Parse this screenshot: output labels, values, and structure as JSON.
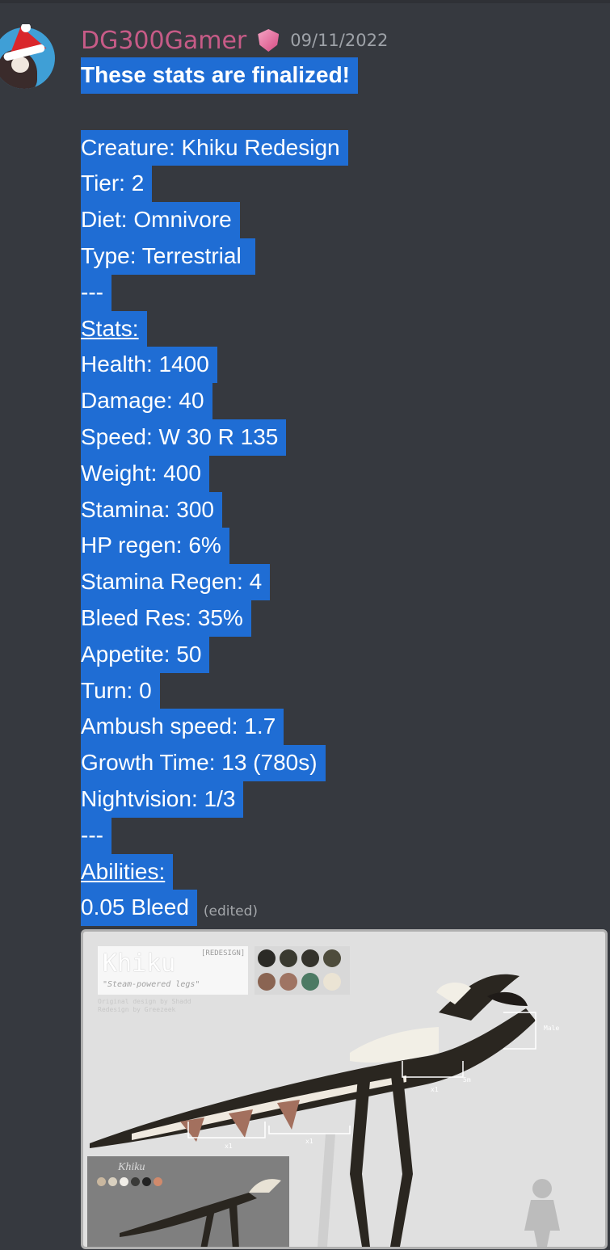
{
  "message": {
    "username": "DG300Gamer",
    "timestamp": "09/11/2022",
    "edited_label": "(edited)",
    "lines": [
      {
        "text": "These stats are finalized!",
        "style": "bold"
      },
      {
        "text": "",
        "style": "blank"
      },
      {
        "text": "Creature: Khiku Redesign",
        "style": "normal"
      },
      {
        "text": "Tier: 2",
        "style": "normal"
      },
      {
        "text": "Diet: Omnivore",
        "style": "normal"
      },
      {
        "text": "Type: Terrestrial ",
        "style": "normal"
      },
      {
        "text": "---",
        "style": "normal"
      },
      {
        "text": "Stats:",
        "style": "underline"
      },
      {
        "text": "Health: 1400",
        "style": "normal"
      },
      {
        "text": "Damage: 40",
        "style": "normal"
      },
      {
        "text": "Speed: W 30 R 135",
        "style": "normal"
      },
      {
        "text": "Weight: 400",
        "style": "normal"
      },
      {
        "text": "Stamina: 300",
        "style": "normal"
      },
      {
        "text": "HP regen: 6%",
        "style": "normal"
      },
      {
        "text": "Stamina Regen: 4",
        "style": "normal"
      },
      {
        "text": "Bleed Res: 35%",
        "style": "normal"
      },
      {
        "text": "Appetite: 50",
        "style": "normal"
      },
      {
        "text": "Turn: 0",
        "style": "normal"
      },
      {
        "text": "Ambush speed: 1.7",
        "style": "normal"
      },
      {
        "text": "Growth Time: 13 (780s)",
        "style": "normal"
      },
      {
        "text": "Nightvision: 1/3",
        "style": "normal"
      },
      {
        "text": "---",
        "style": "normal"
      },
      {
        "text": "Abilities:",
        "style": "underline"
      },
      {
        "text": "0.05 Bleed",
        "style": "normal"
      }
    ]
  },
  "attachment": {
    "title": "Khiku",
    "tag": "[REDESIGN]",
    "subtitle": "\"Steam-powered legs\"",
    "credits_line1": "Original design by Shadd",
    "credits_line2": "Redesign by Greezeek",
    "size_label": "Male",
    "measure_labels": [
      "5m",
      "x1",
      "x1",
      "x1"
    ],
    "inset_title": "Khiku",
    "palette_colors": [
      "#2b2a26",
      "#3a3a30",
      "#34332c",
      "#4e4c3c",
      "#8a6452",
      "#9f7463",
      "#4c7a64",
      "#ebe4d4"
    ],
    "inset_palette_colors": [
      "#c9b79f",
      "#d9d0bf",
      "#f1eee8",
      "#3a3a38",
      "#222222",
      "#d08a6c"
    ]
  },
  "colors": {
    "background": "#36393f",
    "selection": "#1f6dd4",
    "username": "#c75b87",
    "timestamp": "#9ea2a8"
  }
}
